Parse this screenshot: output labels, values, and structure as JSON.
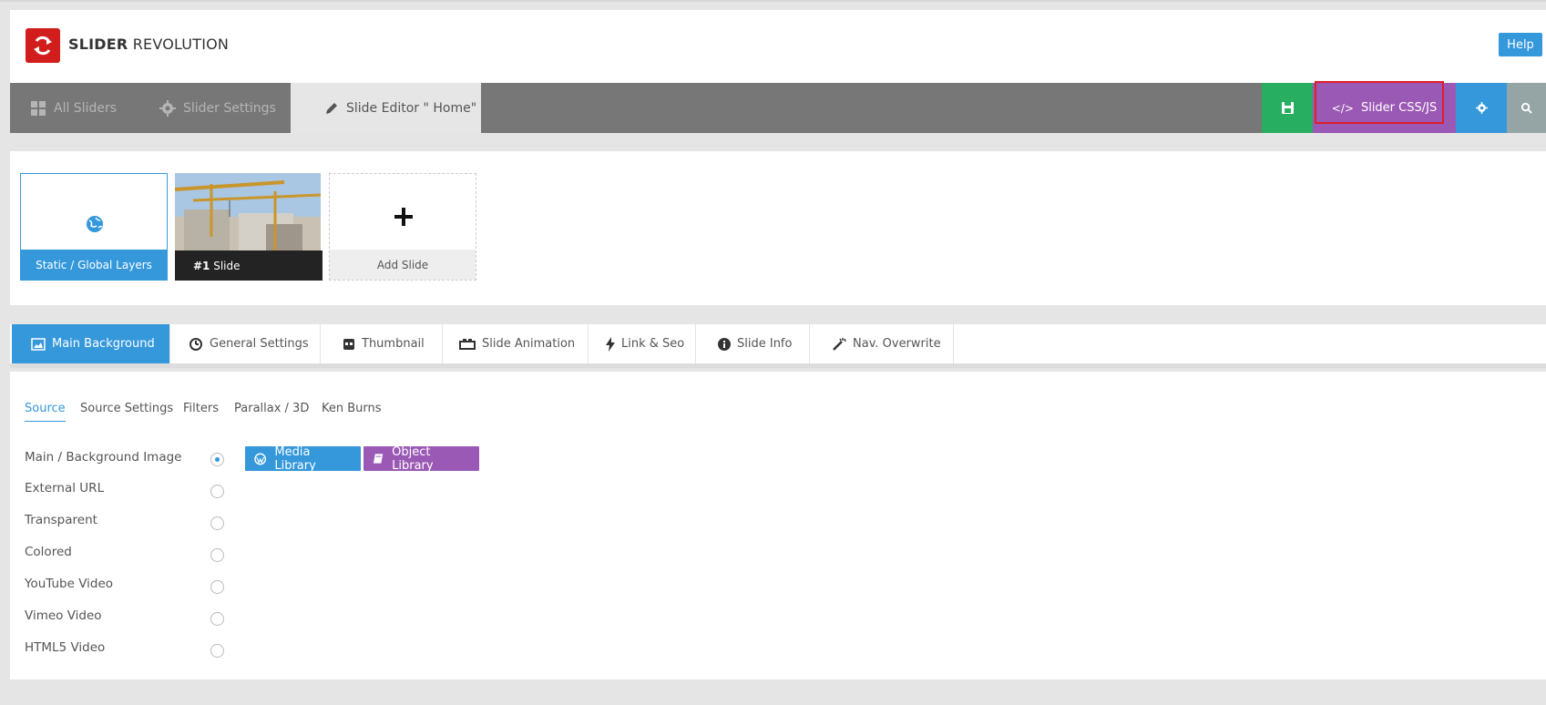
{
  "header": {
    "logo_bold": "SLIDER",
    "logo_light": "REVOLUTION",
    "help_label": "Help"
  },
  "toolbar": {
    "all_sliders": "All Sliders",
    "slider_settings": "Slider Settings",
    "slide_editor": "Slide Editor \" Home\"",
    "css_js": "Slider CSS/JS"
  },
  "slides": {
    "static_label": "Static / Global Layers",
    "slide1_label": "Slide",
    "slide1_number": "#1",
    "add_label": "Add Slide"
  },
  "tabs": [
    {
      "label": "Main Background"
    },
    {
      "label": "General Settings"
    },
    {
      "label": "Thumbnail"
    },
    {
      "label": "Slide Animation"
    },
    {
      "label": "Link & Seo"
    },
    {
      "label": "Slide Info"
    },
    {
      "label": "Nav. Overwrite"
    }
  ],
  "subtabs": [
    {
      "label": "Source"
    },
    {
      "label": "Source Settings"
    },
    {
      "label": "Filters"
    },
    {
      "label": "Parallax / 3D"
    },
    {
      "label": "Ken Burns"
    }
  ],
  "sources": [
    {
      "label": "Main / Background Image",
      "checked": true
    },
    {
      "label": "External URL",
      "checked": false
    },
    {
      "label": "Transparent",
      "checked": false
    },
    {
      "label": "Colored",
      "checked": false
    },
    {
      "label": "YouTube Video",
      "checked": false
    },
    {
      "label": "Vimeo Video",
      "checked": false
    },
    {
      "label": "HTML5 Video",
      "checked": false
    }
  ],
  "buttons": {
    "media_library": "Media Library",
    "object_library": "Object Library"
  },
  "colors": {
    "blue": "#3498db",
    "purple": "#9b59b6",
    "green": "#27ae60",
    "red_logo": "#d21d1d",
    "toolbar_gray": "#777777"
  }
}
